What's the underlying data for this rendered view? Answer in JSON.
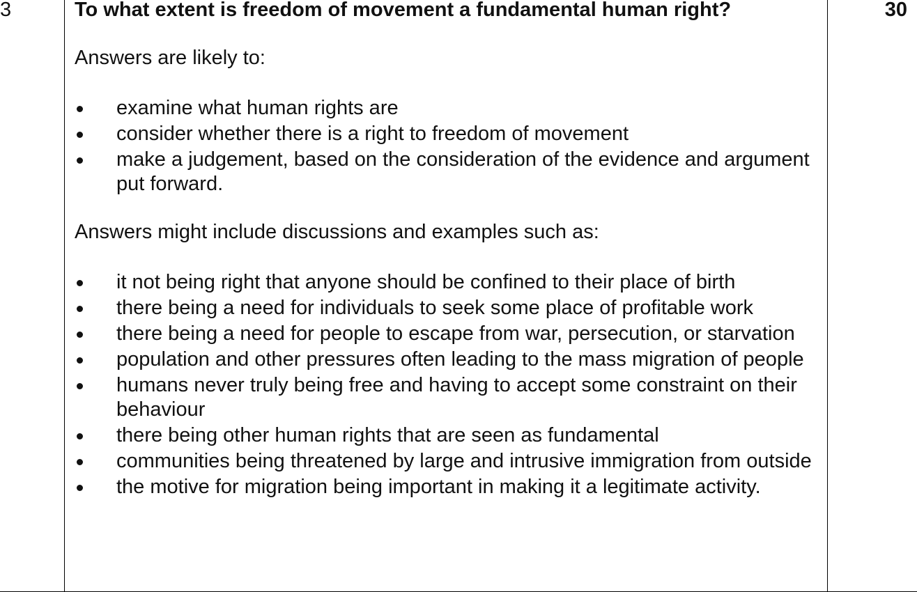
{
  "question_number": "3",
  "question": "To what extent is freedom of movement a fundamental human right?",
  "marks": "30",
  "intro_likely": "Answers are likely to:",
  "likely_points": [
    "examine what human rights are",
    "consider whether there is a right to freedom of movement",
    "make a judgement, based on the consideration of the evidence and argument put forward."
  ],
  "intro_examples": "Answers might include discussions and examples such as:",
  "example_points": [
    "it not being right that anyone should be confined to their place of birth",
    "there being a need for individuals to seek some place of profitable work",
    "there being a need for people to escape from war, persecution, or starvation",
    "population and other pressures often leading to the mass migration of people",
    "humans never truly being free and having to accept some constraint on their behaviour",
    "there being other human rights that are seen as fundamental",
    "communities being threatened by large and intrusive immigration from outside",
    "the motive for migration being important in making it a legitimate activity."
  ]
}
